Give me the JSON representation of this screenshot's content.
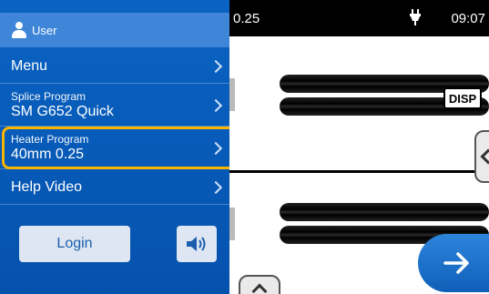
{
  "user": {
    "label": "User",
    "icon": "user-icon"
  },
  "menu": {
    "label": "Menu"
  },
  "splice_program": {
    "label": "Splice Program",
    "value": "SM G652 Quick"
  },
  "heater_program": {
    "label": "Heater Program",
    "value": "40mm 0.25"
  },
  "help_video": {
    "label": "Help Video"
  },
  "login": {
    "label": "Login"
  },
  "speaker": {
    "icon": "speaker-icon"
  },
  "status": {
    "value": "0.25",
    "power_icon": "plug-icon",
    "time": "09:07"
  },
  "view": {
    "disp_label": "DISP"
  },
  "colors": {
    "panel": "#0552ad",
    "user_bar": "#3f86d8",
    "highlight": "#f7b500",
    "next_button": "#1f6fc8"
  }
}
